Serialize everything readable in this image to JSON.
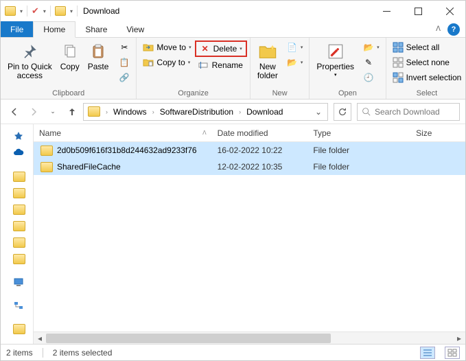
{
  "window": {
    "title": "Download"
  },
  "tabs": {
    "file": "File",
    "home": "Home",
    "share": "Share",
    "view": "View"
  },
  "ribbon": {
    "clipboard": {
      "label": "Clipboard",
      "pin": "Pin to Quick\naccess",
      "copy": "Copy",
      "paste": "Paste"
    },
    "organize": {
      "label": "Organize",
      "move_to": "Move to",
      "copy_to": "Copy to",
      "delete": "Delete",
      "rename": "Rename"
    },
    "new": {
      "label": "New",
      "new_folder": "New\nfolder"
    },
    "open": {
      "label": "Open",
      "properties": "Properties"
    },
    "select": {
      "label": "Select",
      "select_all": "Select all",
      "select_none": "Select none",
      "invert": "Invert selection"
    }
  },
  "breadcrumb": [
    "Windows",
    "SoftwareDistribution",
    "Download"
  ],
  "search": {
    "placeholder": "Search Download"
  },
  "columns": {
    "name": "Name",
    "date": "Date modified",
    "type": "Type",
    "size": "Size"
  },
  "rows": [
    {
      "name": "2d0b509f616f31b8d244632ad9233f76",
      "date": "16-02-2022 10:22",
      "type": "File folder",
      "size": ""
    },
    {
      "name": "SharedFileCache",
      "date": "12-02-2022 10:35",
      "type": "File folder",
      "size": ""
    }
  ],
  "status": {
    "items": "2 items",
    "selected": "2 items selected"
  }
}
